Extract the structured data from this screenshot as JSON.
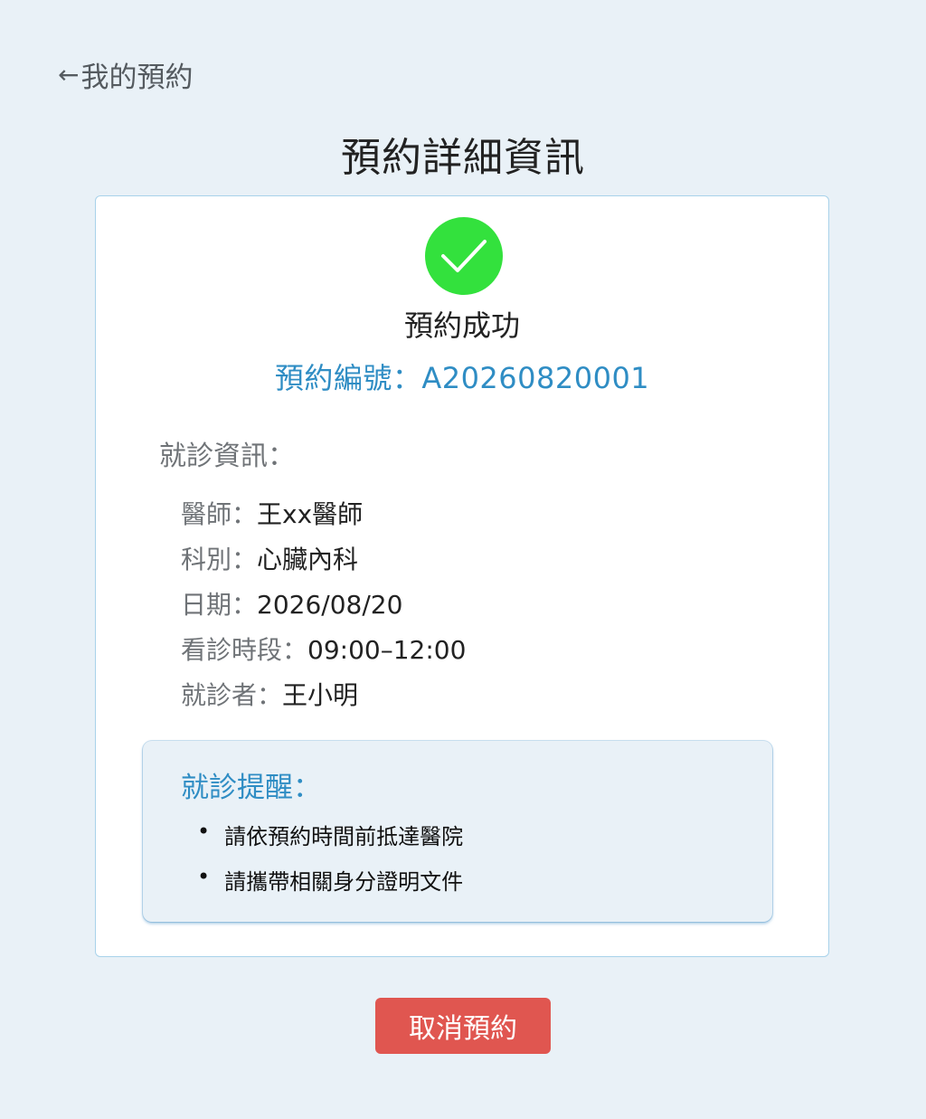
{
  "header": {
    "back_label": "我的預約",
    "title": "預約詳細資訊"
  },
  "status": {
    "icon": "checkmark-icon",
    "text": "預約成功",
    "booking_number": "預約編號：A20260820001"
  },
  "visit_info": {
    "label": "就診資訊：",
    "items": [
      {
        "key": "醫師：",
        "value": "王xx醫師"
      },
      {
        "key": "科別：",
        "value": "心臟內科"
      },
      {
        "key": "日期：",
        "value": "2026/08/20"
      },
      {
        "key": "看診時段：",
        "value": "09:00–12:00"
      },
      {
        "key": "就診者：",
        "value": "王小明"
      }
    ]
  },
  "reminder": {
    "title": "就診提醒：",
    "items": [
      "請依預約時間前抵達醫院",
      "請攜帶相關身分證明文件"
    ]
  },
  "actions": {
    "cancel_label": "取消預約"
  },
  "colors": {
    "background": "#e9f1f7",
    "accent": "#2f8dc4",
    "success": "#33e13d",
    "danger": "#e05650"
  }
}
